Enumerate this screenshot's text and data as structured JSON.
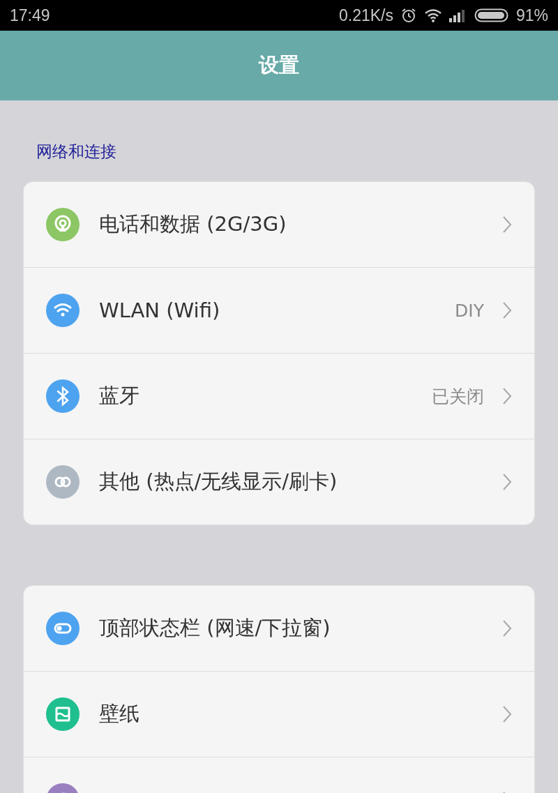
{
  "status_bar": {
    "time": "17:49",
    "speed": "0.21K/s",
    "battery": "91%"
  },
  "header": {
    "title": "设置"
  },
  "sections": [
    {
      "title": "网络和连接",
      "items": [
        {
          "label": "电话和数据 (2G/3G)",
          "color": "#8cc665"
        },
        {
          "label": "WLAN (Wifi)",
          "value": "DIY",
          "color": "#4da3ef"
        },
        {
          "label": "蓝牙",
          "value": "已关闭",
          "color": "#4da3ef"
        },
        {
          "label": "其他 (热点/无线显示/刷卡)",
          "color": "#adb8c2"
        }
      ]
    },
    {
      "items": [
        {
          "label": "顶部状态栏 (网速/下拉窗)",
          "color": "#4da3ef"
        },
        {
          "label": "壁纸",
          "color": "#1fbf8f"
        },
        {
          "color": "#9a7fc0"
        }
      ]
    }
  ]
}
